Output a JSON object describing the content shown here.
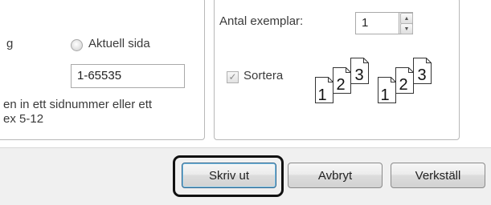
{
  "page_range": {
    "partial_label": "g",
    "current_page_label": "Aktuell sida",
    "pages_value": "1-65535",
    "hint_line1": "en in ett sidnummer eller ett",
    "hint_line2": " ex 5-12"
  },
  "copies": {
    "label": "Antal exemplar:",
    "count": "1",
    "collate_label": "Sortera",
    "collate_checked": true,
    "collated_pages": [
      "1",
      "2",
      "3"
    ],
    "uncollated_pages": [
      "1",
      "2",
      "3"
    ]
  },
  "buttons": {
    "print": "Skriv ut",
    "cancel": "Avbryt",
    "apply": "Verkställ"
  }
}
